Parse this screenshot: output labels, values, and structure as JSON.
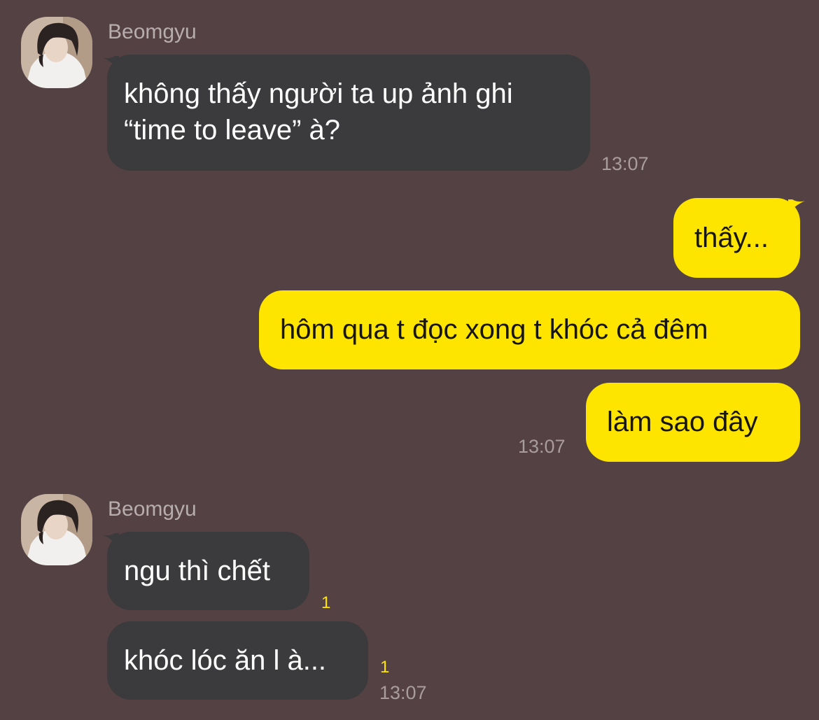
{
  "chat": {
    "group1": {
      "sender": "Beomgyu",
      "message": {
        "line1": "không thấy người ta up ảnh ghi",
        "line2": "“time to leave” à?"
      },
      "time": "13:07"
    },
    "outgoing": {
      "messages": [
        "thấy...",
        "hôm qua t đọc xong t khóc cả đêm",
        "làm sao đây"
      ],
      "time": "13:07"
    },
    "group2": {
      "sender": "Beomgyu",
      "messages": [
        {
          "text": "ngu thì chết",
          "unread": "1"
        },
        {
          "text": "khóc lóc ăn l à...",
          "unread": "1"
        }
      ],
      "time": "13:07"
    }
  },
  "colors": {
    "background": "#544143",
    "incoming_bubble": "#3b3a3c",
    "outgoing_bubble": "#fee500",
    "unread_count": "#fee500"
  },
  "icons": {
    "avatar": "profile-photo"
  }
}
